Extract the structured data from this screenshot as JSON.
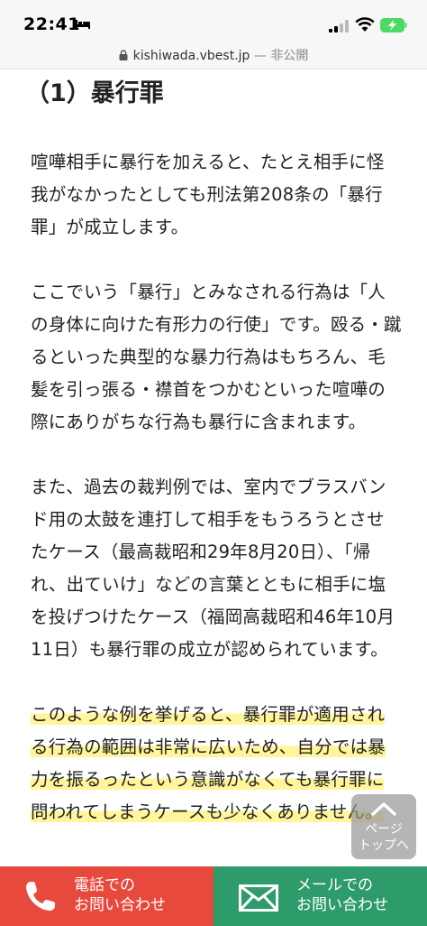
{
  "status_bar": {
    "time": "22:41"
  },
  "url_bar": {
    "domain": "kishiwada.vbest.jp",
    "separator": " — ",
    "status": "非公開"
  },
  "article": {
    "heading": "（1）暴行罪",
    "paragraphs": [
      "喧嘩相手に暴行を加えると、たとえ相手に怪我がなかったとしても刑法第208条の「暴行罪」が成立します。",
      "ここでいう「暴行」とみなされる行為は「人の身体に向けた有形力の行使」です。殴る・蹴るといった典型的な暴力行為はもちろん、毛髪を引っ張る・襟首をつかむといった喧嘩の際にありがちな行為も暴行に含まれます。",
      "また、過去の裁判例では、室内でブラスバンド用の太鼓を連打して相手をもうろうとさせたケース（最高裁昭和29年8月20日）、「帰れ、出ていけ」などの言葉とともに相手に塩を投げつけたケース（福岡高裁昭和46年10月11日）も暴行罪の成立が認められています。"
    ],
    "highlight": "このような例を挙げると、暴行罪が適用される行為の範囲は非常に広いため、自分では暴力を振るったという意識がなくても暴行罪に問われてしまうケースも少なくありません。"
  },
  "page_top": {
    "line1": "ページ",
    "line2": "トップへ"
  },
  "footer": {
    "tel": {
      "line1": "電話での",
      "line2": "お問い合わせ",
      "color": "#e8493d"
    },
    "mail": {
      "line1": "メールでの",
      "line2": "お問い合わせ",
      "color": "#2e9b6a"
    }
  }
}
